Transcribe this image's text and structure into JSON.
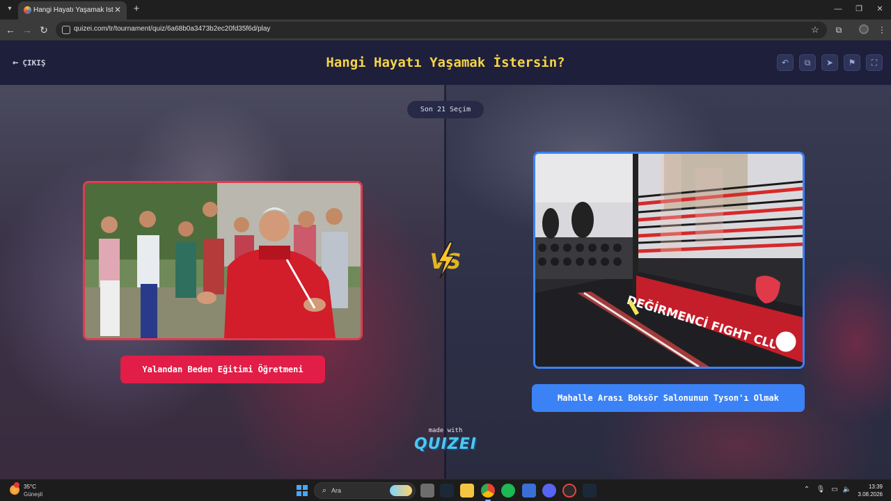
{
  "browser": {
    "tab_title": "Hangi Hayatı Yaşamak İstersin?",
    "url": "quizei.com/tr/tournament/quiz/6a68b0a3473b2ec20fd35f6d/play"
  },
  "header": {
    "exit_label": "ÇIKIŞ",
    "title": "Hangi Hayatı Yaşamak İstersin?",
    "action_icons": [
      "undo-icon",
      "copy-icon",
      "send-icon",
      "flag-icon",
      "fullscreen-icon"
    ]
  },
  "round": {
    "label": "Son 21 Seçim"
  },
  "choices": [
    {
      "label": "Yalandan Beden Eğitimi Öğretmeni",
      "color": "#e11d48"
    },
    {
      "label": "Mahalle Arası Boksör Salonunun Tyson'ı Olmak",
      "color": "#3b82f6"
    }
  ],
  "versus": {
    "text": "VS"
  },
  "footer": {
    "made_with": "made with",
    "brand": "QUIZEI"
  },
  "images": {
    "right_banner_text": "DEĞİRMENCİ FIGHT CLUB"
  },
  "taskbar": {
    "weather_temp": "35°C",
    "weather_desc": "Güneşli",
    "search_placeholder": "Ara",
    "time": "13:39",
    "date": "3.08.2026"
  }
}
